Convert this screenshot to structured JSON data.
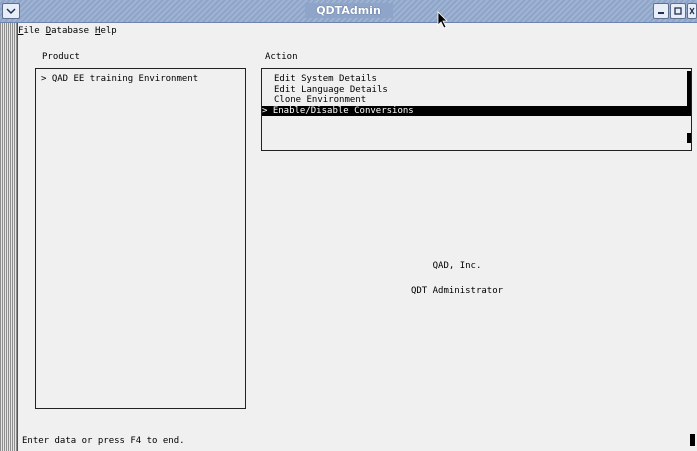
{
  "window": {
    "title": "QDTAdmin"
  },
  "menu": [
    {
      "hot": "F",
      "rest": "ile"
    },
    {
      "hot": "D",
      "rest": "atabase"
    },
    {
      "hot": "H",
      "rest": "elp"
    }
  ],
  "product": {
    "label": "Product",
    "items": [
      "> QAD EE training Environment"
    ]
  },
  "action": {
    "label": "Action",
    "items": [
      "Edit System Details",
      "Edit Language Details",
      "Clone Environment",
      "> Enable/Disable Conversions"
    ],
    "selected_index": 3
  },
  "info": {
    "company": "QAD, Inc.",
    "app_name": "QDT Administrator"
  },
  "status": {
    "message": "Enter data or press F4 to end."
  }
}
